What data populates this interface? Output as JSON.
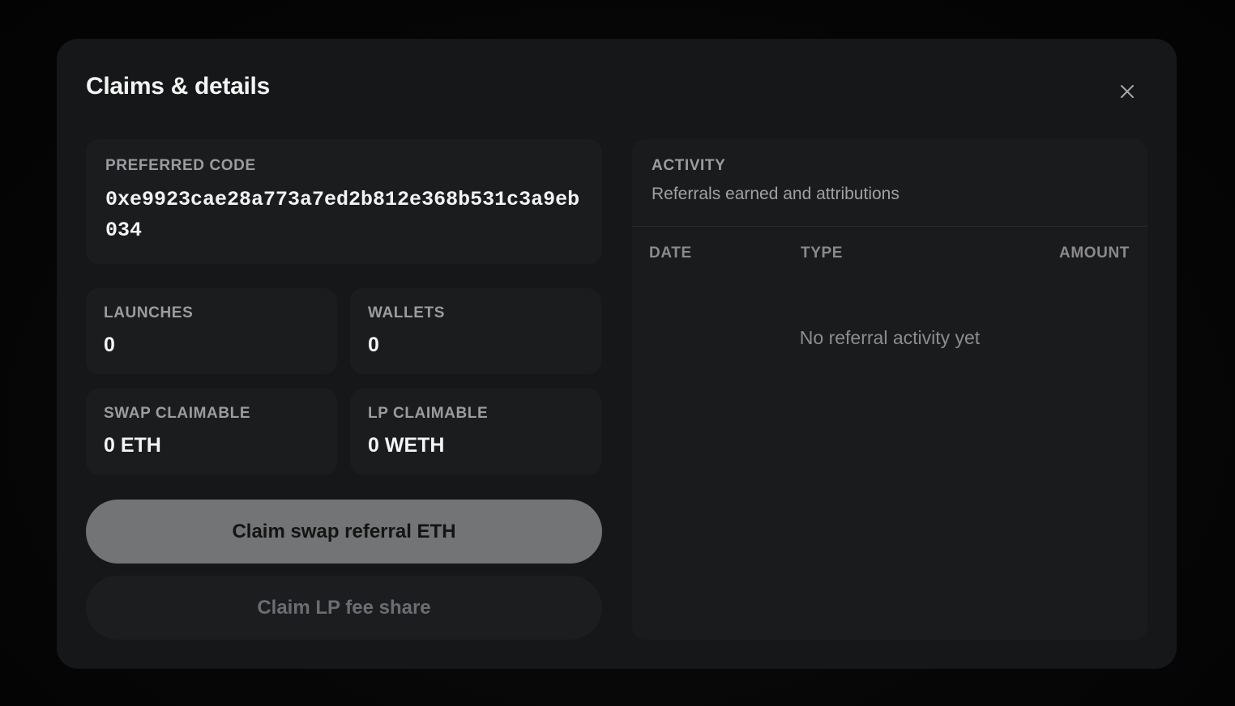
{
  "modal": {
    "title": "Claims & details",
    "close_icon": "close-icon"
  },
  "preferred_code": {
    "label": "PREFERRED CODE",
    "value": "0xe9923cae28a773a7ed2b812e368b531c3a9eb034"
  },
  "stats": {
    "launches": {
      "label": "LAUNCHES",
      "value": "0"
    },
    "wallets": {
      "label": "WALLETS",
      "value": "0"
    },
    "swap_claimable": {
      "label": "SWAP CLAIMABLE",
      "value": "0 ETH"
    },
    "lp_claimable": {
      "label": "LP CLAIMABLE",
      "value": "0 WETH"
    }
  },
  "buttons": {
    "claim_swap": "Claim swap referral ETH",
    "claim_lp": "Claim LP fee share"
  },
  "activity": {
    "title": "ACTIVITY",
    "subtitle": "Referrals earned and attributions",
    "columns": {
      "date": "DATE",
      "type": "TYPE",
      "amount": "AMOUNT"
    },
    "empty_message": "No referral activity yet"
  },
  "colors": {
    "modal_bg": "#161718",
    "card_bg": "#1b1c1e",
    "primary_button_bg": "#737475",
    "secondary_button_bg": "#1c1d1f"
  }
}
